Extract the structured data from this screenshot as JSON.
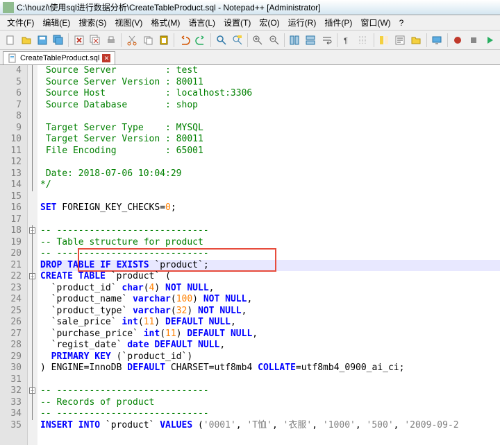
{
  "titlebar": {
    "path": "C:\\houzi\\使用sql进行数据分析\\CreateTableProduct.sql - Notepad++ [Administrator]"
  },
  "menu": [
    "文件(F)",
    "编辑(E)",
    "搜索(S)",
    "视图(V)",
    "格式(M)",
    "语言(L)",
    "设置(T)",
    "宏(O)",
    "运行(R)",
    "插件(P)",
    "窗口(W)",
    "?"
  ],
  "tab": {
    "name": "CreateTableProduct.sql"
  },
  "lines": [
    {
      "n": 4,
      "spans": [
        {
          "t": " Source Server         : test",
          "c": "c-green"
        }
      ]
    },
    {
      "n": 5,
      "spans": [
        {
          "t": " Source Server Version : 80011",
          "c": "c-green"
        }
      ]
    },
    {
      "n": 6,
      "spans": [
        {
          "t": " Source Host           : localhost:3306",
          "c": "c-green"
        }
      ]
    },
    {
      "n": 7,
      "spans": [
        {
          "t": " Source Database       : shop",
          "c": "c-green"
        }
      ]
    },
    {
      "n": 8,
      "spans": [
        {
          "t": "",
          "c": "c-green"
        }
      ]
    },
    {
      "n": 9,
      "spans": [
        {
          "t": " Target Server Type    : MYSQL",
          "c": "c-green"
        }
      ]
    },
    {
      "n": 10,
      "spans": [
        {
          "t": " Target Server Version : 80011",
          "c": "c-green"
        }
      ]
    },
    {
      "n": 11,
      "spans": [
        {
          "t": " File Encoding         : 65001",
          "c": "c-green"
        }
      ]
    },
    {
      "n": 12,
      "spans": [
        {
          "t": "",
          "c": "c-green"
        }
      ]
    },
    {
      "n": 13,
      "spans": [
        {
          "t": " Date: 2018-07-06 10:04:29",
          "c": "c-green"
        }
      ]
    },
    {
      "n": 14,
      "spans": [
        {
          "t": "*/",
          "c": "c-green"
        }
      ]
    },
    {
      "n": 15,
      "spans": [
        {
          "t": "",
          "c": ""
        }
      ]
    },
    {
      "n": 16,
      "spans": [
        {
          "t": "SET",
          "c": "c-blue"
        },
        {
          "t": " FOREIGN_KEY_CHECKS",
          "c": "c-black"
        },
        {
          "t": "=",
          "c": "c-black"
        },
        {
          "t": "0",
          "c": "c-orange"
        },
        {
          "t": ";",
          "c": "c-black"
        }
      ]
    },
    {
      "n": 17,
      "spans": [
        {
          "t": "",
          "c": ""
        }
      ]
    },
    {
      "n": 18,
      "spans": [
        {
          "t": "-- ----------------------------",
          "c": "c-green"
        }
      ],
      "fold": "-"
    },
    {
      "n": 19,
      "spans": [
        {
          "t": "-- Table structure for product",
          "c": "c-green"
        }
      ]
    },
    {
      "n": 20,
      "spans": [
        {
          "t": "-- ----------------------------",
          "c": "c-green"
        }
      ]
    },
    {
      "n": 21,
      "hl": true,
      "redbox": true,
      "spans": [
        {
          "t": "DROP",
          "c": "c-blue"
        },
        {
          "t": " ",
          "c": ""
        },
        {
          "t": "TABLE",
          "c": "c-blue"
        },
        {
          "t": " ",
          "c": ""
        },
        {
          "t": "IF",
          "c": "c-blue"
        },
        {
          "t": " ",
          "c": ""
        },
        {
          "t": "EXISTS",
          "c": "c-blue"
        },
        {
          "t": " `product`;",
          "c": "c-black"
        }
      ]
    },
    {
      "n": 22,
      "spans": [
        {
          "t": "CREATE",
          "c": "c-blue"
        },
        {
          "t": " ",
          "c": ""
        },
        {
          "t": "TABLE",
          "c": "c-blue"
        },
        {
          "t": " `product` ",
          "c": "c-black"
        },
        {
          "t": "(",
          "c": "c-black"
        }
      ],
      "fold": "-"
    },
    {
      "n": 23,
      "spans": [
        {
          "t": "  `product_id` ",
          "c": "c-black"
        },
        {
          "t": "char",
          "c": "c-blue"
        },
        {
          "t": "(",
          "c": "c-black"
        },
        {
          "t": "4",
          "c": "c-orange"
        },
        {
          "t": ") ",
          "c": "c-black"
        },
        {
          "t": "NOT",
          "c": "c-blue"
        },
        {
          "t": " ",
          "c": ""
        },
        {
          "t": "NULL",
          "c": "c-blue"
        },
        {
          "t": ",",
          "c": "c-black"
        }
      ]
    },
    {
      "n": 24,
      "spans": [
        {
          "t": "  `product_name` ",
          "c": "c-black"
        },
        {
          "t": "varchar",
          "c": "c-blue"
        },
        {
          "t": "(",
          "c": "c-black"
        },
        {
          "t": "100",
          "c": "c-orange"
        },
        {
          "t": ") ",
          "c": "c-black"
        },
        {
          "t": "NOT",
          "c": "c-blue"
        },
        {
          "t": " ",
          "c": ""
        },
        {
          "t": "NULL",
          "c": "c-blue"
        },
        {
          "t": ",",
          "c": "c-black"
        }
      ]
    },
    {
      "n": 25,
      "spans": [
        {
          "t": "  `product_type` ",
          "c": "c-black"
        },
        {
          "t": "varchar",
          "c": "c-blue"
        },
        {
          "t": "(",
          "c": "c-black"
        },
        {
          "t": "32",
          "c": "c-orange"
        },
        {
          "t": ") ",
          "c": "c-black"
        },
        {
          "t": "NOT",
          "c": "c-blue"
        },
        {
          "t": " ",
          "c": ""
        },
        {
          "t": "NULL",
          "c": "c-blue"
        },
        {
          "t": ",",
          "c": "c-black"
        }
      ]
    },
    {
      "n": 26,
      "spans": [
        {
          "t": "  `sale_price` ",
          "c": "c-black"
        },
        {
          "t": "int",
          "c": "c-blue"
        },
        {
          "t": "(",
          "c": "c-black"
        },
        {
          "t": "11",
          "c": "c-orange"
        },
        {
          "t": ") ",
          "c": "c-black"
        },
        {
          "t": "DEFAULT",
          "c": "c-blue"
        },
        {
          "t": " ",
          "c": ""
        },
        {
          "t": "NULL",
          "c": "c-blue"
        },
        {
          "t": ",",
          "c": "c-black"
        }
      ]
    },
    {
      "n": 27,
      "spans": [
        {
          "t": "  `purchase_price` ",
          "c": "c-black"
        },
        {
          "t": "int",
          "c": "c-blue"
        },
        {
          "t": "(",
          "c": "c-black"
        },
        {
          "t": "11",
          "c": "c-orange"
        },
        {
          "t": ") ",
          "c": "c-black"
        },
        {
          "t": "DEFAULT",
          "c": "c-blue"
        },
        {
          "t": " ",
          "c": ""
        },
        {
          "t": "NULL",
          "c": "c-blue"
        },
        {
          "t": ",",
          "c": "c-black"
        }
      ]
    },
    {
      "n": 28,
      "spans": [
        {
          "t": "  `regist_date` ",
          "c": "c-black"
        },
        {
          "t": "date",
          "c": "c-blue"
        },
        {
          "t": " ",
          "c": ""
        },
        {
          "t": "DEFAULT",
          "c": "c-blue"
        },
        {
          "t": " ",
          "c": ""
        },
        {
          "t": "NULL",
          "c": "c-blue"
        },
        {
          "t": ",",
          "c": "c-black"
        }
      ]
    },
    {
      "n": 29,
      "spans": [
        {
          "t": "  ",
          "c": ""
        },
        {
          "t": "PRIMARY",
          "c": "c-blue"
        },
        {
          "t": " ",
          "c": ""
        },
        {
          "t": "KEY",
          "c": "c-blue"
        },
        {
          "t": " (`product_id`)",
          "c": "c-black"
        }
      ]
    },
    {
      "n": 30,
      "spans": [
        {
          "t": ") ENGINE",
          "c": "c-black"
        },
        {
          "t": "=",
          "c": "c-black"
        },
        {
          "t": "InnoDB ",
          "c": "c-black"
        },
        {
          "t": "DEFAULT",
          "c": "c-blue"
        },
        {
          "t": " CHARSET",
          "c": "c-black"
        },
        {
          "t": "=",
          "c": "c-black"
        },
        {
          "t": "utf8mb4 ",
          "c": "c-black"
        },
        {
          "t": "COLLATE",
          "c": "c-blue"
        },
        {
          "t": "=",
          "c": "c-black"
        },
        {
          "t": "utf8mb4_0900_ai_ci;",
          "c": "c-black"
        }
      ]
    },
    {
      "n": 31,
      "spans": [
        {
          "t": "",
          "c": ""
        }
      ]
    },
    {
      "n": 32,
      "spans": [
        {
          "t": "-- ----------------------------",
          "c": "c-green"
        }
      ],
      "fold": "-"
    },
    {
      "n": 33,
      "spans": [
        {
          "t": "-- Records of product",
          "c": "c-green"
        }
      ]
    },
    {
      "n": 34,
      "spans": [
        {
          "t": "-- ----------------------------",
          "c": "c-green"
        }
      ]
    },
    {
      "n": 35,
      "spans": [
        {
          "t": "INSERT",
          "c": "c-blue"
        },
        {
          "t": " ",
          "c": ""
        },
        {
          "t": "INTO",
          "c": "c-blue"
        },
        {
          "t": " `product` ",
          "c": "c-black"
        },
        {
          "t": "VALUES",
          "c": "c-blue"
        },
        {
          "t": " (",
          "c": "c-black"
        },
        {
          "t": "'0001'",
          "c": "c-gray"
        },
        {
          "t": ", ",
          "c": "c-black"
        },
        {
          "t": "'T恤'",
          "c": "c-gray"
        },
        {
          "t": ", ",
          "c": "c-black"
        },
        {
          "t": "'衣服'",
          "c": "c-gray"
        },
        {
          "t": ", ",
          "c": "c-black"
        },
        {
          "t": "'1000'",
          "c": "c-gray"
        },
        {
          "t": ", ",
          "c": "c-black"
        },
        {
          "t": "'500'",
          "c": "c-gray"
        },
        {
          "t": ", ",
          "c": "c-black"
        },
        {
          "t": "'2009-09-2",
          "c": "c-gray"
        }
      ]
    }
  ]
}
